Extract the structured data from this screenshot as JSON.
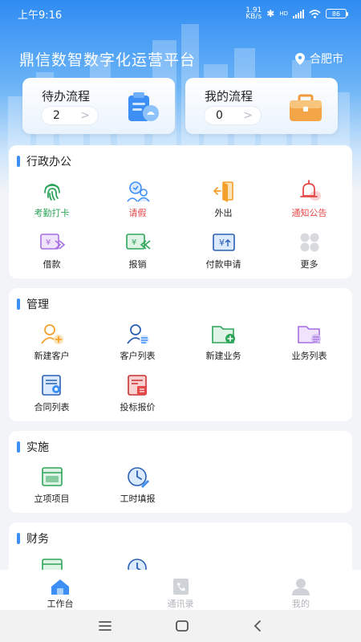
{
  "status_bar": {
    "time": "上午9:16",
    "net_speed_top": "1.91",
    "net_speed_unit": "KB/s",
    "hd": "HD",
    "battery": "86"
  },
  "header": {
    "title": "鼎信数智数字化运营平台",
    "location": "合肥市"
  },
  "flow_cards": [
    {
      "label": "待办流程",
      "count": "2",
      "chevron": ">"
    },
    {
      "label": "我的流程",
      "count": "0",
      "chevron": ">"
    }
  ],
  "sections": {
    "admin": {
      "title": "行政办公",
      "items": [
        "考勤打卡",
        "请假",
        "外出",
        "通知公告",
        "借款",
        "报销",
        "付款申请",
        "更多"
      ]
    },
    "manage": {
      "title": "管理",
      "items": [
        "新建客户",
        "客户列表",
        "新建业务",
        "业务列表",
        "合同列表",
        "投标报价"
      ]
    },
    "implement": {
      "title": "实施",
      "items": [
        "立项项目",
        "工时填报"
      ]
    },
    "finance": {
      "title": "财务"
    }
  },
  "tabbar": {
    "tabs": [
      "工作台",
      "通讯录",
      "我的"
    ]
  },
  "colors": {
    "accent": "#3d8ef5",
    "green": "#2ea55a",
    "red": "#e54848",
    "orange": "#f4a02d",
    "purple": "#a66fe0"
  }
}
